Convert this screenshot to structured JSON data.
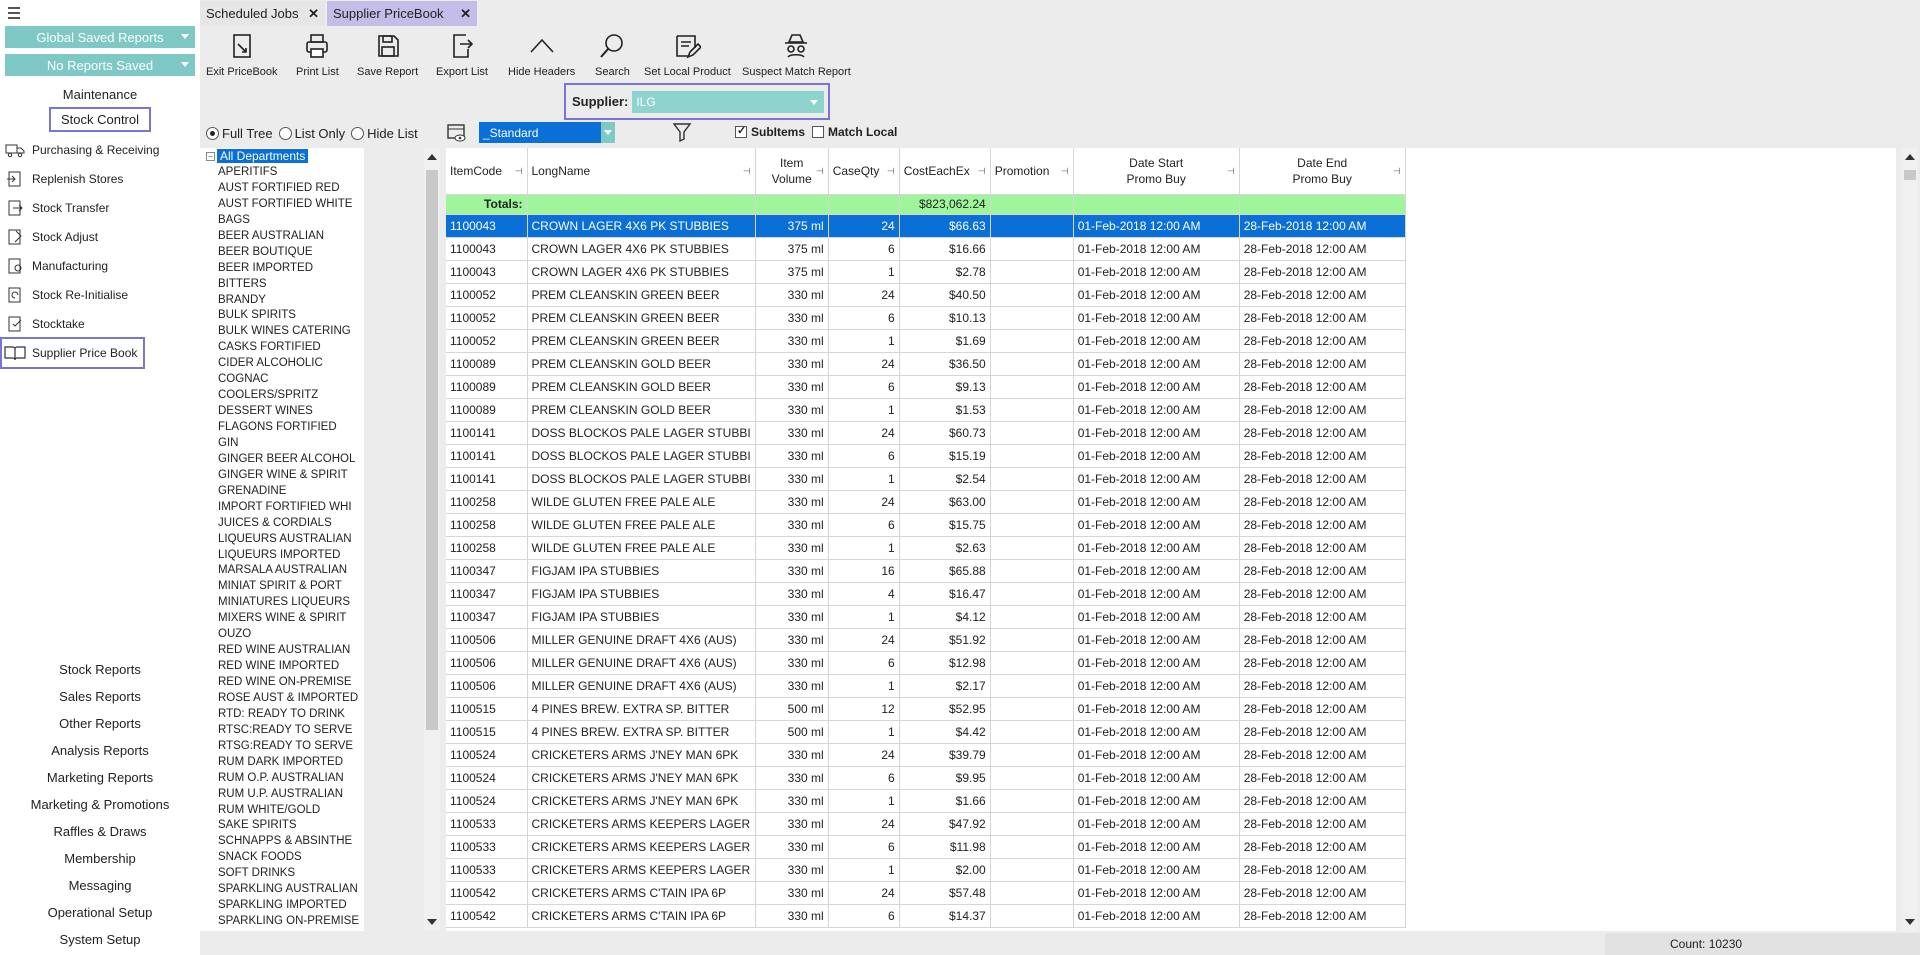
{
  "sidebar": {
    "global_saved_reports": "Global Saved Reports",
    "no_reports_saved": "No Reports Saved",
    "maintenance": "Maintenance",
    "stock_control": "Stock Control",
    "items": [
      {
        "label": "Purchasing & Receiving",
        "icon": "truck-icon"
      },
      {
        "label": "Replenish Stores",
        "icon": "replenish-icon"
      },
      {
        "label": "Stock Transfer",
        "icon": "transfer-icon"
      },
      {
        "label": "Stock Adjust",
        "icon": "adjust-icon"
      },
      {
        "label": "Manufacturing",
        "icon": "manufacturing-icon"
      },
      {
        "label": "Stock Re-Initialise",
        "icon": "reinitialise-icon"
      },
      {
        "label": "Stocktake",
        "icon": "stocktake-icon"
      },
      {
        "label": "Supplier Price Book",
        "icon": "book-icon"
      }
    ],
    "reports": [
      "Stock Reports",
      "Sales Reports",
      "Other Reports",
      "Analysis Reports",
      "Marketing Reports",
      "Marketing & Promotions",
      "Raffles & Draws",
      "Membership",
      "Messaging",
      "Operational Setup",
      "System Setup"
    ]
  },
  "tabs": [
    {
      "label": "Scheduled Jobs"
    },
    {
      "label": "Supplier PriceBook"
    }
  ],
  "toolbar": [
    {
      "label": "Exit PriceBook",
      "icon": "exit-icon"
    },
    {
      "label": "Print List",
      "icon": "print-icon"
    },
    {
      "label": "Save Report",
      "icon": "save-icon"
    },
    {
      "label": "Export List",
      "icon": "export-icon"
    },
    {
      "label": "Hide Headers",
      "icon": "chevron-up-icon"
    },
    {
      "label": "Search",
      "icon": "search-icon"
    },
    {
      "label": "Set Local Product",
      "icon": "edit-icon"
    },
    {
      "label": "Suspect Match Report",
      "icon": "spy-icon"
    }
  ],
  "supplier": {
    "label": "Supplier:",
    "value": "ILG"
  },
  "view_options": {
    "full_tree": "Full Tree",
    "list_only": "List Only",
    "hide_list": "Hide List",
    "selected": "Full Tree"
  },
  "layout": "_Standard",
  "subitems": {
    "label": "SubItems",
    "checked": true
  },
  "match_local": {
    "label": "Match Local",
    "checked": false
  },
  "tree": {
    "root": "All Departments",
    "items": [
      "APERITIFS",
      "AUST FORTIFIED RED",
      "AUST FORTIFIED WHITE",
      "BAGS",
      "BEER AUSTRALIAN",
      "BEER BOUTIQUE",
      "BEER IMPORTED",
      "BITTERS",
      "BRANDY",
      "BULK SPIRITS",
      "BULK WINES CATERING",
      "CASKS FORTIFIED",
      "CIDER ALCOHOLIC",
      "COGNAC",
      "COOLERS/SPRITZ",
      "DESSERT WINES",
      "FLAGONS FORTIFIED",
      "GIN",
      "GINGER BEER ALCOHOL",
      "GINGER WINE & SPIRIT",
      "GRENADINE",
      "IMPORT FORTIFIED WHI",
      "JUICES & CORDIALS",
      "LIQUEURS AUSTRALIAN",
      "LIQUEURS IMPORTED",
      "MARSALA AUSTRALIAN",
      "MINIAT SPIRIT & PORT",
      "MINIATURES LIQUEURS",
      "MIXERS WINE & SPIRIT",
      "OUZO",
      "RED WINE AUSTRALIAN",
      "RED WINE IMPORTED",
      "RED WINE ON-PREMISE",
      "ROSE AUST & IMPORTED",
      "RTD: READY TO DRINK",
      "RTSC:READY TO SERVE",
      "RTSG:READY TO SERVE",
      "RUM DARK IMPORTED",
      "RUM O.P. AUSTRALIAN",
      "RUM U.P. AUSTRALIAN",
      "RUM WHITE/GOLD",
      "SAKE SPIRITS",
      "SCHNAPPS & ABSINTHE",
      "SNACK FOODS",
      "SOFT DRINKS",
      "SPARKLING AUSTRALIAN",
      "SPARKLING IMPORTED",
      "SPARKLING ON-PREMISE"
    ]
  },
  "grid": {
    "headers": [
      "ItemCode",
      "LongName",
      "Item Volume",
      "CaseQty",
      "CostEachEx",
      "Promotion",
      "Date Start Promo Buy",
      "Date End Promo Buy"
    ],
    "totals_label": "Totals:",
    "totals_cost": "$823,062.24",
    "rows": [
      [
        "1100043",
        "CROWN LAGER 4X6 PK STUBBIES",
        "375 ml",
        "24",
        "$66.63",
        "",
        "01-Feb-2018 12:00 AM",
        "28-Feb-2018 12:00 AM"
      ],
      [
        "1100043",
        "CROWN LAGER 4X6 PK STUBBIES",
        "375 ml",
        "6",
        "$16.66",
        "",
        "01-Feb-2018 12:00 AM",
        "28-Feb-2018 12:00 AM"
      ],
      [
        "1100043",
        "CROWN LAGER 4X6 PK STUBBIES",
        "375 ml",
        "1",
        "$2.78",
        "",
        "01-Feb-2018 12:00 AM",
        "28-Feb-2018 12:00 AM"
      ],
      [
        "1100052",
        "PREM CLEANSKIN GREEN BEER",
        "330 ml",
        "24",
        "$40.50",
        "",
        "01-Feb-2018 12:00 AM",
        "28-Feb-2018 12:00 AM"
      ],
      [
        "1100052",
        "PREM CLEANSKIN GREEN BEER",
        "330 ml",
        "6",
        "$10.13",
        "",
        "01-Feb-2018 12:00 AM",
        "28-Feb-2018 12:00 AM"
      ],
      [
        "1100052",
        "PREM CLEANSKIN GREEN BEER",
        "330 ml",
        "1",
        "$1.69",
        "",
        "01-Feb-2018 12:00 AM",
        "28-Feb-2018 12:00 AM"
      ],
      [
        "1100089",
        "PREM CLEANSKIN GOLD BEER",
        "330 ml",
        "24",
        "$36.50",
        "",
        "01-Feb-2018 12:00 AM",
        "28-Feb-2018 12:00 AM"
      ],
      [
        "1100089",
        "PREM CLEANSKIN GOLD BEER",
        "330 ml",
        "6",
        "$9.13",
        "",
        "01-Feb-2018 12:00 AM",
        "28-Feb-2018 12:00 AM"
      ],
      [
        "1100089",
        "PREM CLEANSKIN GOLD BEER",
        "330 ml",
        "1",
        "$1.53",
        "",
        "01-Feb-2018 12:00 AM",
        "28-Feb-2018 12:00 AM"
      ],
      [
        "1100141",
        "DOSS BLOCKOS PALE LAGER STUBBI",
        "330 ml",
        "24",
        "$60.73",
        "",
        "01-Feb-2018 12:00 AM",
        "28-Feb-2018 12:00 AM"
      ],
      [
        "1100141",
        "DOSS BLOCKOS PALE LAGER STUBBI",
        "330 ml",
        "6",
        "$15.19",
        "",
        "01-Feb-2018 12:00 AM",
        "28-Feb-2018 12:00 AM"
      ],
      [
        "1100141",
        "DOSS BLOCKOS PALE LAGER STUBBI",
        "330 ml",
        "1",
        "$2.54",
        "",
        "01-Feb-2018 12:00 AM",
        "28-Feb-2018 12:00 AM"
      ],
      [
        "1100258",
        "WILDE GLUTEN FREE PALE ALE",
        "330 ml",
        "24",
        "$63.00",
        "",
        "01-Feb-2018 12:00 AM",
        "28-Feb-2018 12:00 AM"
      ],
      [
        "1100258",
        "WILDE GLUTEN FREE PALE ALE",
        "330 ml",
        "6",
        "$15.75",
        "",
        "01-Feb-2018 12:00 AM",
        "28-Feb-2018 12:00 AM"
      ],
      [
        "1100258",
        "WILDE GLUTEN FREE PALE ALE",
        "330 ml",
        "1",
        "$2.63",
        "",
        "01-Feb-2018 12:00 AM",
        "28-Feb-2018 12:00 AM"
      ],
      [
        "1100347",
        "FIGJAM IPA STUBBIES",
        "330 ml",
        "16",
        "$65.88",
        "",
        "01-Feb-2018 12:00 AM",
        "28-Feb-2018 12:00 AM"
      ],
      [
        "1100347",
        "FIGJAM IPA STUBBIES",
        "330 ml",
        "4",
        "$16.47",
        "",
        "01-Feb-2018 12:00 AM",
        "28-Feb-2018 12:00 AM"
      ],
      [
        "1100347",
        "FIGJAM IPA STUBBIES",
        "330 ml",
        "1",
        "$4.12",
        "",
        "01-Feb-2018 12:00 AM",
        "28-Feb-2018 12:00 AM"
      ],
      [
        "1100506",
        "MILLER GENUINE DRAFT 4X6 (AUS)",
        "330 ml",
        "24",
        "$51.92",
        "",
        "01-Feb-2018 12:00 AM",
        "28-Feb-2018 12:00 AM"
      ],
      [
        "1100506",
        "MILLER GENUINE DRAFT 4X6 (AUS)",
        "330 ml",
        "6",
        "$12.98",
        "",
        "01-Feb-2018 12:00 AM",
        "28-Feb-2018 12:00 AM"
      ],
      [
        "1100506",
        "MILLER GENUINE DRAFT 4X6 (AUS)",
        "330 ml",
        "1",
        "$2.17",
        "",
        "01-Feb-2018 12:00 AM",
        "28-Feb-2018 12:00 AM"
      ],
      [
        "1100515",
        "4 PINES BREW. EXTRA SP. BITTER",
        "500 ml",
        "12",
        "$52.95",
        "",
        "01-Feb-2018 12:00 AM",
        "28-Feb-2018 12:00 AM"
      ],
      [
        "1100515",
        "4 PINES BREW. EXTRA SP. BITTER",
        "500 ml",
        "1",
        "$4.42",
        "",
        "01-Feb-2018 12:00 AM",
        "28-Feb-2018 12:00 AM"
      ],
      [
        "1100524",
        "CRICKETERS ARMS J'NEY MAN 6PK",
        "330 ml",
        "24",
        "$39.79",
        "",
        "01-Feb-2018 12:00 AM",
        "28-Feb-2018 12:00 AM"
      ],
      [
        "1100524",
        "CRICKETERS ARMS J'NEY MAN 6PK",
        "330 ml",
        "6",
        "$9.95",
        "",
        "01-Feb-2018 12:00 AM",
        "28-Feb-2018 12:00 AM"
      ],
      [
        "1100524",
        "CRICKETERS ARMS J'NEY MAN 6PK",
        "330 ml",
        "1",
        "$1.66",
        "",
        "01-Feb-2018 12:00 AM",
        "28-Feb-2018 12:00 AM"
      ],
      [
        "1100533",
        "CRICKETERS ARMS KEEPERS LAGER",
        "330 ml",
        "24",
        "$47.92",
        "",
        "01-Feb-2018 12:00 AM",
        "28-Feb-2018 12:00 AM"
      ],
      [
        "1100533",
        "CRICKETERS ARMS KEEPERS LAGER",
        "330 ml",
        "6",
        "$11.98",
        "",
        "01-Feb-2018 12:00 AM",
        "28-Feb-2018 12:00 AM"
      ],
      [
        "1100533",
        "CRICKETERS ARMS KEEPERS LAGER",
        "330 ml",
        "1",
        "$2.00",
        "",
        "01-Feb-2018 12:00 AM",
        "28-Feb-2018 12:00 AM"
      ],
      [
        "1100542",
        "CRICKETERS ARMS C'TAIN IPA 6P",
        "330 ml",
        "24",
        "$57.48",
        "",
        "01-Feb-2018 12:00 AM",
        "28-Feb-2018 12:00 AM"
      ],
      [
        "1100542",
        "CRICKETERS ARMS C'TAIN IPA 6P",
        "330 ml",
        "6",
        "$14.37",
        "",
        "01-Feb-2018 12:00 AM",
        "28-Feb-2018 12:00 AM"
      ]
    ]
  },
  "status": {
    "count": "Count: 10230"
  },
  "colors": {
    "accent_teal": "#7ec9c6",
    "selection_blue": "#0a6fd6",
    "totals_green": "#9ef59a",
    "highlight_purple": "#7a74d8"
  }
}
